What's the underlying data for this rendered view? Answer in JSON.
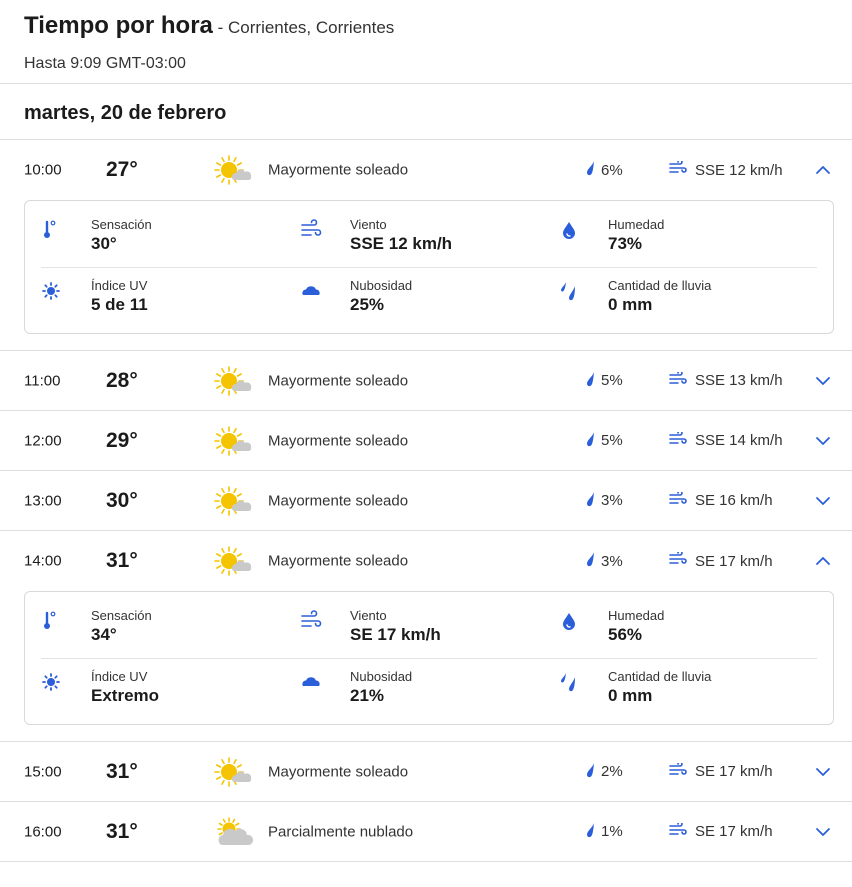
{
  "header": {
    "title": "Tiempo por hora",
    "location": " - Corrientes, Corrientes",
    "subtitle": "Hasta 9:09 GMT-03:00"
  },
  "date_label": "martes, 20 de febrero",
  "colors": {
    "accent": "#2b5fd9",
    "sun": "#f5c400",
    "cloud": "#c9c9c9"
  },
  "hours": [
    {
      "time": "10:00",
      "temp": "27°",
      "icon": "mostly-sunny-icon",
      "condition": "Mayormente soleado",
      "precip": "6%",
      "wind": "SSE 12 km/h",
      "expanded": true,
      "details": {
        "sensacion_label": "Sensación",
        "sensacion": "30°",
        "viento_label": "Viento",
        "viento": "SSE 12 km/h",
        "humedad_label": "Humedad",
        "humedad": "73%",
        "uv_label": "Índice UV",
        "uv": "5 de 11",
        "nubosidad_label": "Nubosidad",
        "nubosidad": "25%",
        "lluvia_label": "Cantidad de lluvia",
        "lluvia": "0 mm"
      }
    },
    {
      "time": "11:00",
      "temp": "28°",
      "icon": "mostly-sunny-icon",
      "condition": "Mayormente soleado",
      "precip": "5%",
      "wind": "SSE 13 km/h",
      "expanded": false
    },
    {
      "time": "12:00",
      "temp": "29°",
      "icon": "mostly-sunny-icon",
      "condition": "Mayormente soleado",
      "precip": "5%",
      "wind": "SSE 14 km/h",
      "expanded": false
    },
    {
      "time": "13:00",
      "temp": "30°",
      "icon": "mostly-sunny-icon",
      "condition": "Mayormente soleado",
      "precip": "3%",
      "wind": "SE 16 km/h",
      "expanded": false
    },
    {
      "time": "14:00",
      "temp": "31°",
      "icon": "mostly-sunny-icon",
      "condition": "Mayormente soleado",
      "precip": "3%",
      "wind": "SE 17 km/h",
      "expanded": true,
      "details": {
        "sensacion_label": "Sensación",
        "sensacion": "34°",
        "viento_label": "Viento",
        "viento": "SE 17 km/h",
        "humedad_label": "Humedad",
        "humedad": "56%",
        "uv_label": "Índice UV",
        "uv": "Extremo",
        "nubosidad_label": "Nubosidad",
        "nubosidad": "21%",
        "lluvia_label": "Cantidad de lluvia",
        "lluvia": "0 mm"
      }
    },
    {
      "time": "15:00",
      "temp": "31°",
      "icon": "mostly-sunny-icon",
      "condition": "Mayormente soleado",
      "precip": "2%",
      "wind": "SE 17 km/h",
      "expanded": false
    },
    {
      "time": "16:00",
      "temp": "31°",
      "icon": "partly-cloudy-icon",
      "condition": "Parcialmente nublado",
      "precip": "1%",
      "wind": "SE 17 km/h",
      "expanded": false
    }
  ]
}
